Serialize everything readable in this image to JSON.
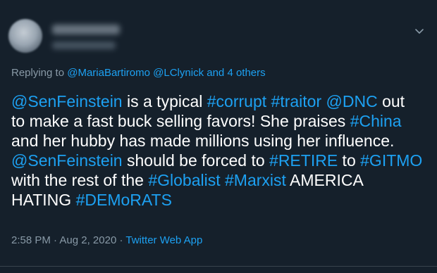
{
  "reply": {
    "prefix": "Replying to",
    "mention1": "@MariaBartiromo",
    "mention2": "@LClynick",
    "suffix": "and 4 others"
  },
  "tweet_lines": [
    [
      {
        "t": "@SenFeinstein",
        "link": true
      },
      {
        "t": " is a typical ",
        "link": false
      },
      {
        "t": "#corrupt",
        "link": true
      },
      {
        "t": " ",
        "link": false
      },
      {
        "t": "#traitor",
        "link": true
      },
      {
        "t": " ",
        "link": false
      },
      {
        "t": "@DNC",
        "link": true
      },
      {
        "t": " out",
        "link": false
      }
    ],
    [
      {
        "t": "to make a fast buck selling favors! She praises ",
        "link": false
      },
      {
        "t": "#China",
        "link": true
      }
    ],
    [
      {
        "t": "and her hubby has made millions using her influence.",
        "link": false
      }
    ],
    [
      {
        "t": "@SenFeinstein",
        "link": true
      },
      {
        "t": " should be forced to ",
        "link": false
      },
      {
        "t": "#RETIRE",
        "link": true
      },
      {
        "t": " to ",
        "link": false
      },
      {
        "t": "#GITMO",
        "link": true
      }
    ],
    [
      {
        "t": "with the rest of the ",
        "link": false
      },
      {
        "t": "#Globalist",
        "link": true
      },
      {
        "t": " ",
        "link": false
      },
      {
        "t": "#Marxist",
        "link": true
      },
      {
        "t": " AMERICA",
        "link": false
      }
    ],
    [
      {
        "t": "HATING ",
        "link": false
      },
      {
        "t": "#DEMoRATS",
        "link": true
      }
    ]
  ],
  "meta": {
    "time": "2:58 PM",
    "sep1": " · ",
    "date": "Aug 2, 2020",
    "sep2": " · ",
    "app": "Twitter Web App"
  },
  "icons": {
    "caret": "chevron-down-icon",
    "avatar": "avatar"
  },
  "colors": {
    "background": "#15202b",
    "link": "#1da1f2",
    "secondary_text": "#8899a6",
    "primary_text": "#ffffff"
  }
}
